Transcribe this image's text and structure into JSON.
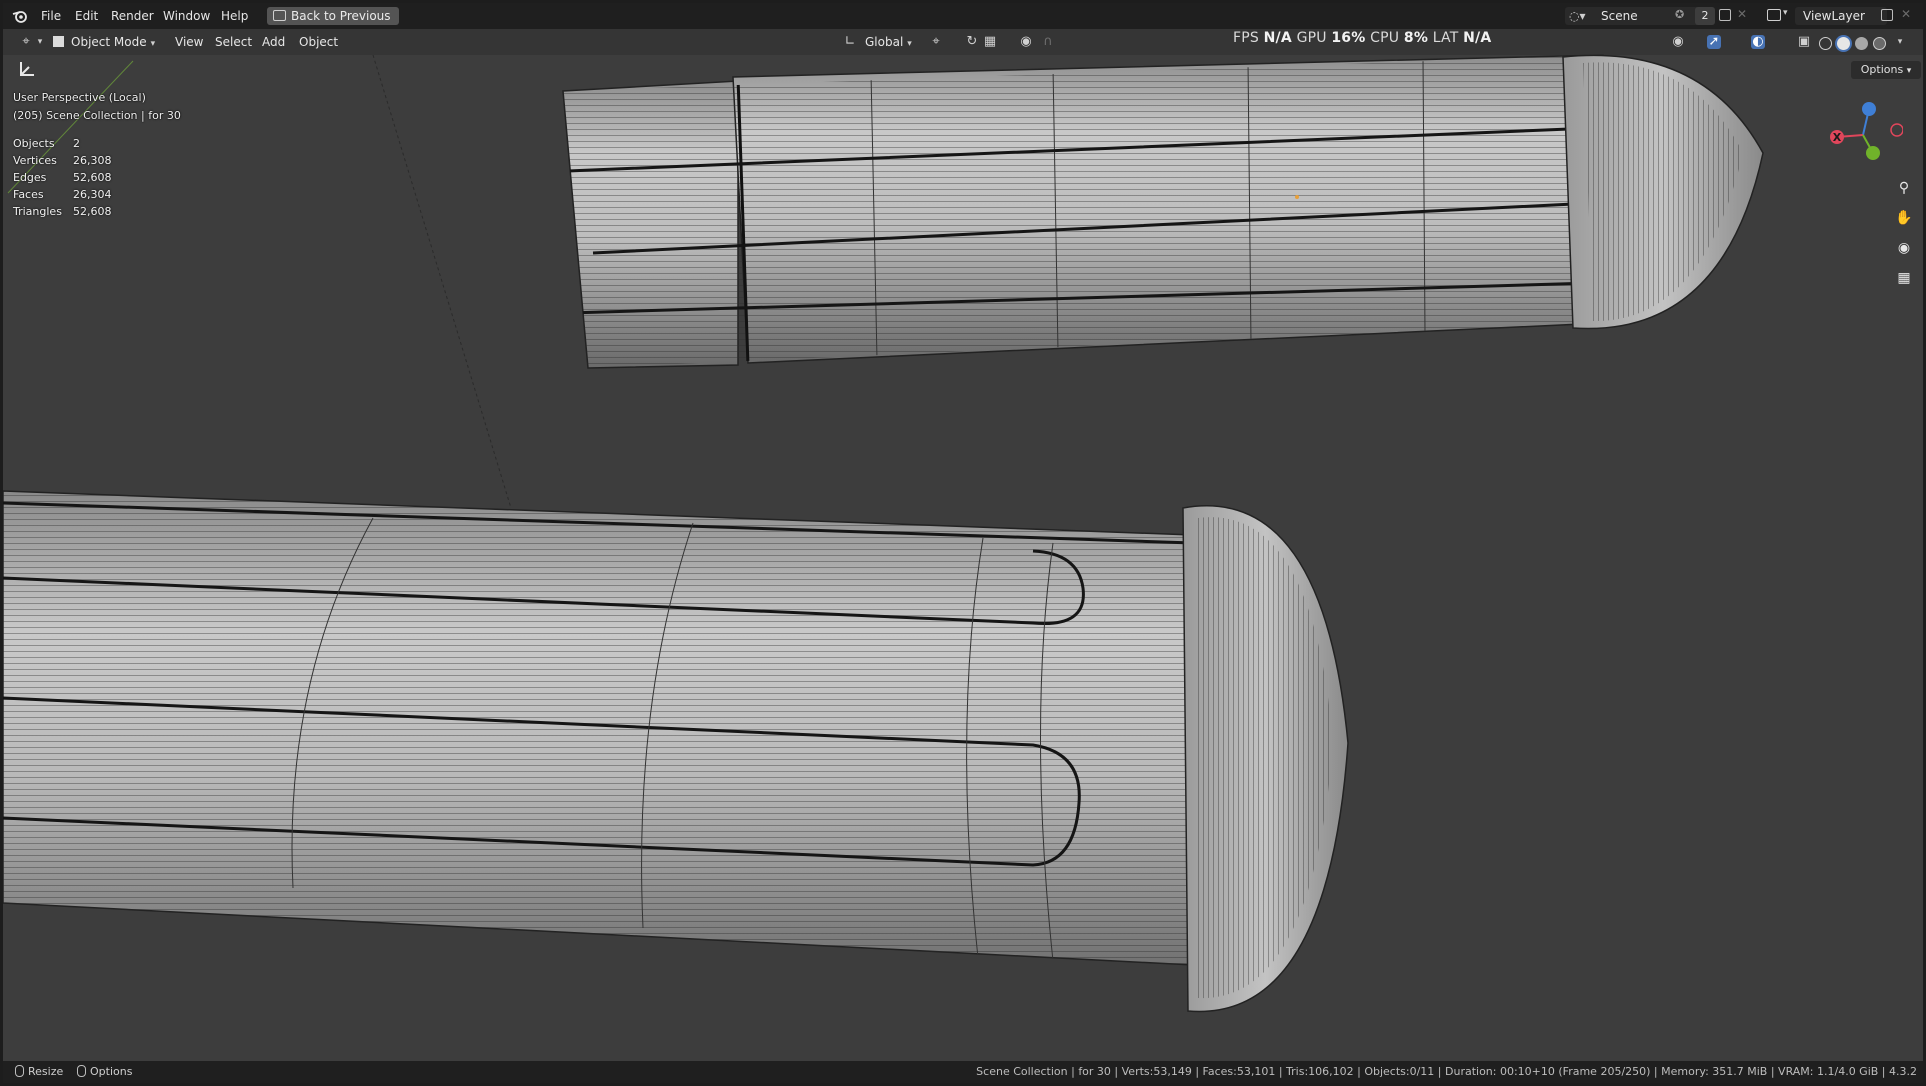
{
  "menu": {
    "items": [
      "File",
      "Edit",
      "Render",
      "Window",
      "Help"
    ],
    "back_button": "Back to Previous"
  },
  "scene_selector": {
    "name": "Scene",
    "user_count": "2"
  },
  "view_layer": {
    "name": "ViewLayer"
  },
  "viewport_header": {
    "mode": "Object Mode",
    "menus": [
      "View",
      "Select",
      "Add",
      "Object"
    ],
    "transform_orientation": "Global",
    "options_label": "Options"
  },
  "performance": {
    "fps_label": "FPS",
    "fps": "N/A",
    "gpu_label": "GPU",
    "gpu": "16%",
    "cpu_label": "CPU",
    "cpu": "8%",
    "lat_label": "LAT",
    "lat": "N/A"
  },
  "overlay": {
    "view_name": "User Perspective (Local)",
    "collection_line": "(205) Scene Collection | for 30",
    "stats": [
      {
        "label": "Objects",
        "value": "2"
      },
      {
        "label": "Vertices",
        "value": "26,308"
      },
      {
        "label": "Edges",
        "value": "52,608"
      },
      {
        "label": "Faces",
        "value": "26,304"
      },
      {
        "label": "Triangles",
        "value": "52,608"
      }
    ]
  },
  "gizmo": {
    "x_label": "X"
  },
  "statusbar": {
    "left": [
      {
        "icon": "mouse-left-icon",
        "label": "Resize"
      },
      {
        "icon": "mouse-right-icon",
        "label": "Options"
      }
    ],
    "right": "Scene Collection | for 30 | Verts:53,149 | Faces:53,101 | Tris:106,102 | Objects:0/11 | Duration: 00:10+10 (Frame 205/250) | Memory: 351.7 MiB | VRAM: 1.1/4.0 GiB | 4.3.2"
  },
  "colors": {
    "viewport_bg": "#3d3d3d",
    "header_bg": "#1f1f1f",
    "accent_blue": "#4772b3",
    "axis_x": "#e0465b",
    "axis_y": "#70b32a",
    "axis_z": "#3f7fd6",
    "mesh_light": "#cfcfcf",
    "wire": "#1a1a1a"
  }
}
